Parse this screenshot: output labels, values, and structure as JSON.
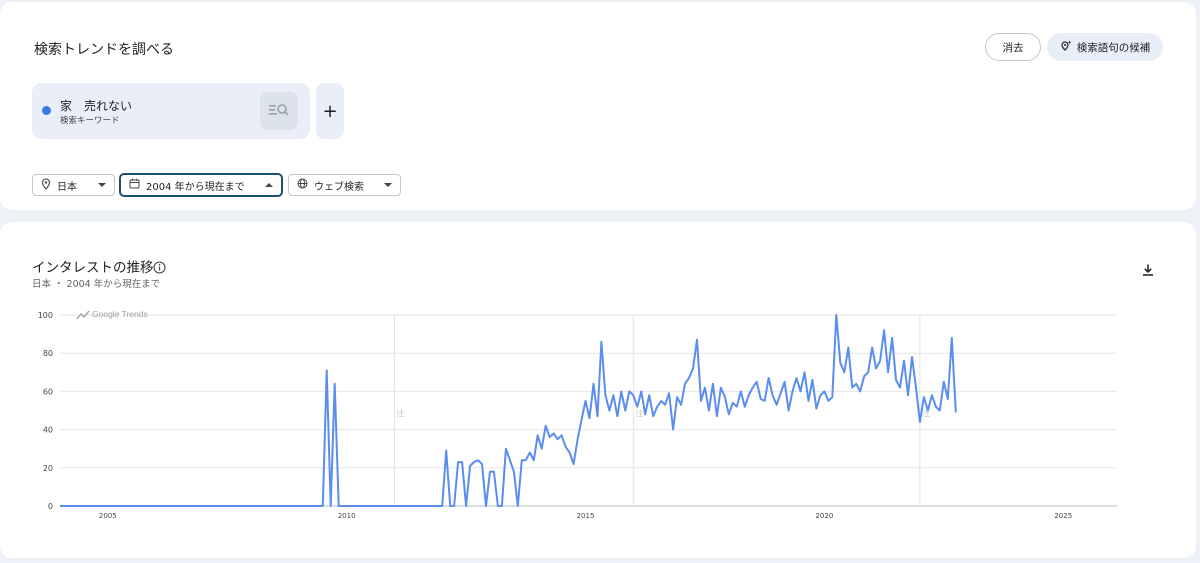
{
  "header": {
    "title": "検索トレンドを調べる",
    "clear_label": "消去",
    "suggest_label": "検索語句の候補"
  },
  "term": {
    "name": "家　売れない",
    "type": "検索キーワード",
    "color": "#3b78e7",
    "add_label": "+"
  },
  "filters": {
    "region": "日本",
    "time": "2004 年から現在まで",
    "search_type": "ウェブ検索"
  },
  "chart_section": {
    "title": "インタレストの推移",
    "subtitle": "日本 ・ 2004 年から現在まで",
    "watermark": "Google Trends",
    "note_marker": "注"
  },
  "chart_data": {
    "type": "line",
    "x_start": 2004.0,
    "x_end": 2026.125,
    "xlim": [
      2004.0,
      2026.125
    ],
    "ylim": [
      0,
      100
    ],
    "yticks": [
      0,
      20,
      40,
      60,
      80,
      100
    ],
    "xticks": [
      "2005",
      "2010",
      "2015",
      "2020",
      "2025"
    ],
    "xtick_values": [
      2005,
      2010,
      2015,
      2020,
      2025
    ],
    "note_years": [
      2011,
      2016,
      2022
    ],
    "grid": true,
    "series": [
      {
        "color": "#5b8def",
        "values": [
          0,
          0,
          0,
          0,
          0,
          0,
          0,
          0,
          0,
          0,
          0,
          0,
          0,
          0,
          0,
          0,
          0,
          0,
          0,
          0,
          0,
          0,
          0,
          0,
          0,
          0,
          0,
          0,
          0,
          0,
          0,
          0,
          0,
          0,
          0,
          0,
          0,
          0,
          0,
          0,
          0,
          0,
          0,
          0,
          0,
          0,
          0,
          0,
          0,
          0,
          0,
          0,
          0,
          0,
          0,
          0,
          0,
          0,
          0,
          0,
          0,
          0,
          0,
          0,
          0,
          0,
          0,
          71,
          0,
          64,
          0,
          0,
          0,
          0,
          0,
          0,
          0,
          0,
          0,
          0,
          0,
          0,
          0,
          0,
          0,
          0,
          0,
          0,
          0,
          0,
          0,
          0,
          0,
          0,
          0,
          0,
          0,
          29,
          0,
          0,
          23,
          23,
          0,
          21,
          23,
          24,
          22,
          0,
          18,
          18,
          0,
          0,
          30,
          24,
          18,
          0,
          24,
          24,
          28,
          24,
          37,
          30,
          42,
          36,
          38,
          35,
          37,
          31,
          28,
          22,
          35,
          45,
          55,
          46,
          64,
          47,
          86,
          58,
          50,
          58,
          47,
          60,
          50,
          60,
          58,
          52,
          60,
          48,
          58,
          47,
          52,
          55,
          53,
          59,
          40,
          57,
          53,
          64,
          67,
          72,
          87,
          55,
          62,
          50,
          64,
          47,
          62,
          57,
          48,
          54,
          52,
          60,
          52,
          58,
          62,
          65,
          56,
          55,
          67,
          58,
          53,
          59,
          65,
          50,
          60,
          67,
          60,
          70,
          55,
          66,
          51,
          58,
          60,
          55,
          57,
          100,
          75,
          70,
          83,
          62,
          64,
          60,
          68,
          70,
          83,
          72,
          76,
          92,
          70,
          88,
          66,
          62,
          76,
          58,
          78,
          62,
          44,
          57,
          50,
          58,
          52,
          50,
          65,
          56,
          88,
          49
        ]
      }
    ]
  }
}
